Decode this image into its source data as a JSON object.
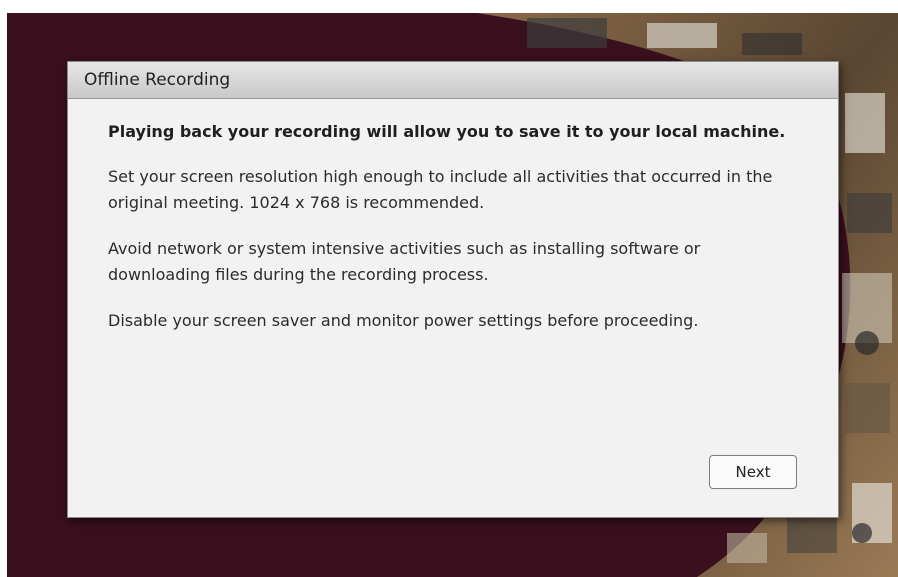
{
  "dialog": {
    "title": "Offline Recording",
    "lead": "Playing back your recording will allow you to save it to your local machine.",
    "paragraphs": [
      "Set your screen resolution high enough to include all activities that occurred in the original meeting. 1024 x 768 is recommended.",
      "Avoid network or system intensive activities such as installing software or downloading files during the recording process.",
      "Disable your screen saver and monitor power settings before proceeding."
    ],
    "next_label": "Next"
  },
  "colors": {
    "background": "#3a0f1e",
    "dialog": "#f2f2f2",
    "titlebar": "#d6d6d6"
  }
}
